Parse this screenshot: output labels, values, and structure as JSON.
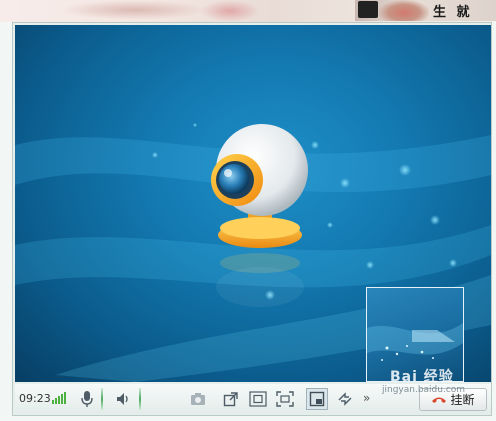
{
  "banner": {
    "ad_text": "生 就 生 通"
  },
  "video": {
    "main_icon": "webcam-icon",
    "pip_icon": "arrow-play-icon"
  },
  "toolbar": {
    "call_time": "09:23",
    "signal_icon": "signal-bars-icon",
    "buttons": [
      {
        "name": "microphone",
        "icon": "microphone-icon"
      },
      {
        "name": "speaker",
        "icon": "speaker-icon"
      },
      {
        "name": "snapshot",
        "icon": "camera-icon"
      },
      {
        "name": "popout",
        "icon": "popout-icon"
      },
      {
        "name": "fit-window",
        "icon": "fit-window-icon"
      },
      {
        "name": "fullscreen",
        "icon": "fullscreen-icon"
      },
      {
        "name": "pip-toggle",
        "icon": "pip-icon",
        "active": true
      },
      {
        "name": "swap",
        "icon": "swap-icon"
      }
    ],
    "more_label": "»",
    "hangup_label": "挂断"
  },
  "watermark": {
    "text": "Bai 经验",
    "url": "jingyan.baidu.com"
  },
  "colors": {
    "video_bg": "#1379b0",
    "signal": "#4cb040",
    "hangup_icon": "#d9462e"
  }
}
